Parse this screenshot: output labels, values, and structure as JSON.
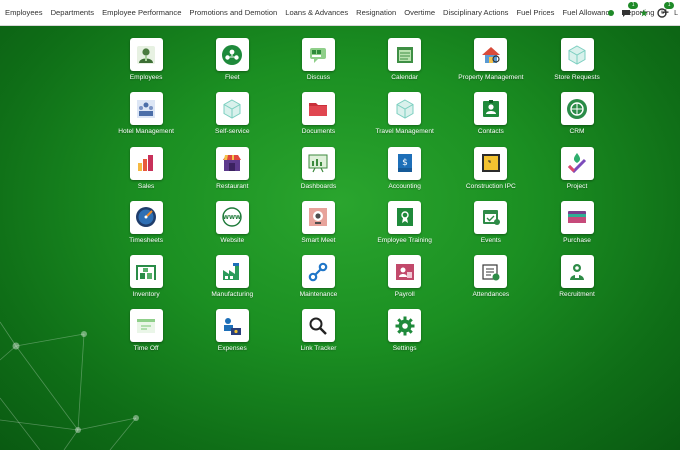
{
  "menu": [
    "Employees",
    "Departments",
    "Employee Performance",
    "Promotions and Demotion",
    "Loans & Advances",
    "Resignation",
    "Overtime",
    "Disciplinary Actions",
    "Fuel Prices",
    "Fuel Allowance",
    "Reporting"
  ],
  "menu_add_label": "+",
  "systray": {
    "chat_badge": "1",
    "activity_badge": "1",
    "user_initial": "L"
  },
  "colors": {
    "accent": "#1f8a28",
    "background": "#1b8f22"
  },
  "apps": [
    {
      "label": "Employees",
      "icon": "employees-icon"
    },
    {
      "label": "Fleet",
      "icon": "fleet-icon"
    },
    {
      "label": "Discuss",
      "icon": "discuss-icon"
    },
    {
      "label": "Calendar",
      "icon": "calendar-icon"
    },
    {
      "label": "Property Management",
      "icon": "property-management-icon"
    },
    {
      "label": "Store Requests",
      "icon": "store-requests-icon"
    },
    {
      "label": "Hotel Management",
      "icon": "hotel-management-icon"
    },
    {
      "label": "Self-service",
      "icon": "self-service-icon"
    },
    {
      "label": "Documents",
      "icon": "documents-icon"
    },
    {
      "label": "Travel Management",
      "icon": "travel-management-icon"
    },
    {
      "label": "Contacts",
      "icon": "contacts-icon"
    },
    {
      "label": "CRM",
      "icon": "crm-icon"
    },
    {
      "label": "Sales",
      "icon": "sales-icon"
    },
    {
      "label": "Restaurant",
      "icon": "restaurant-icon"
    },
    {
      "label": "Dashboards",
      "icon": "dashboards-icon"
    },
    {
      "label": "Accounting",
      "icon": "accounting-icon"
    },
    {
      "label": "Construction IPC",
      "icon": "construction-ipc-icon"
    },
    {
      "label": "Project",
      "icon": "project-icon"
    },
    {
      "label": "Timesheets",
      "icon": "timesheets-icon"
    },
    {
      "label": "Website",
      "icon": "website-icon"
    },
    {
      "label": "Smart Meet",
      "icon": "smart-meet-icon"
    },
    {
      "label": "Employee Training",
      "icon": "employee-training-icon"
    },
    {
      "label": "Events",
      "icon": "events-icon"
    },
    {
      "label": "Purchase",
      "icon": "purchase-icon"
    },
    {
      "label": "Inventory",
      "icon": "inventory-icon"
    },
    {
      "label": "Manufacturing",
      "icon": "manufacturing-icon"
    },
    {
      "label": "Maintenance",
      "icon": "maintenance-icon"
    },
    {
      "label": "Payroll",
      "icon": "payroll-icon"
    },
    {
      "label": "Attendances",
      "icon": "attendances-icon"
    },
    {
      "label": "Recruitment",
      "icon": "recruitment-icon"
    },
    {
      "label": "Time Off",
      "icon": "time-off-icon"
    },
    {
      "label": "Expenses",
      "icon": "expenses-icon"
    },
    {
      "label": "Link Tracker",
      "icon": "link-tracker-icon"
    },
    {
      "label": "Settings",
      "icon": "settings-icon"
    }
  ]
}
